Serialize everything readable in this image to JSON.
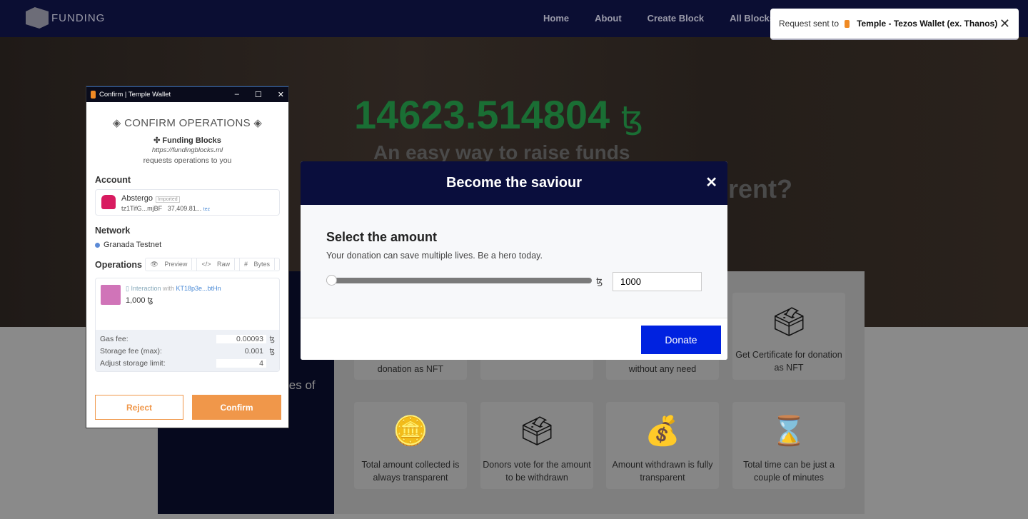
{
  "nav": {
    "logo": "FUNDING",
    "links": [
      "Home",
      "About",
      "Create Block",
      "All Blocks"
    ]
  },
  "toast": {
    "prefix": "Request sent to",
    "wallet": "Temple - Tezos Wallet (ex. Thanos)",
    "close": "✕"
  },
  "hero": {
    "amount": "14623.514804",
    "currency": "ꜩ",
    "tagline": "An easy way to raise funds",
    "tagline2": "rent?"
  },
  "section": {
    "left_text": "ies of",
    "cards": [
      "donation as NFT",
      "",
      "without any need",
      "Get Certificate for donation as NFT",
      "Total amount collected is always transparent",
      "Donors vote for the amount to be withdrawn",
      "Amount withdrawn is fully transparent",
      "Total time can be just a couple of minutes"
    ]
  },
  "modal": {
    "title": "Become the saviour",
    "close": "✕",
    "heading": "Select the amount",
    "subtitle": "Your donation can save multiple lives. Be a hero today.",
    "slider_value": 0,
    "currency": "ꜩ",
    "amount": "1000",
    "donate": "Donate"
  },
  "wallet": {
    "title": "Confirm | Temple Wallet",
    "heading": "CONFIRM OPERATIONS",
    "dapp": "Funding Blocks",
    "url": "https://fundingblocks.ml",
    "request": "requests operations to you",
    "account_label": "Account",
    "account_name": "Abstergo",
    "imported": "Imported",
    "address": "tz1TifG...mjBF",
    "balance": "37,409.81...",
    "balance_unit": "tez",
    "network_label": "Network",
    "network": "Granada Testnet",
    "network_color": "#5b8ad6",
    "operations_label": "Operations",
    "tabs": [
      "Preview",
      "Raw",
      "Bytes"
    ],
    "op_type": "Interaction",
    "op_with": "with",
    "op_contract": "KT18p3e...btHn",
    "op_amount": "1,000 ꜩ",
    "gas_label": "Gas fee:",
    "gas": "0.00093",
    "storage_label": "Storage fee (max):",
    "storage": "0.001",
    "limit_label": "Adjust storage limit:",
    "limit": "4",
    "unit": "ꜩ",
    "reject": "Reject",
    "confirm": "Confirm"
  }
}
